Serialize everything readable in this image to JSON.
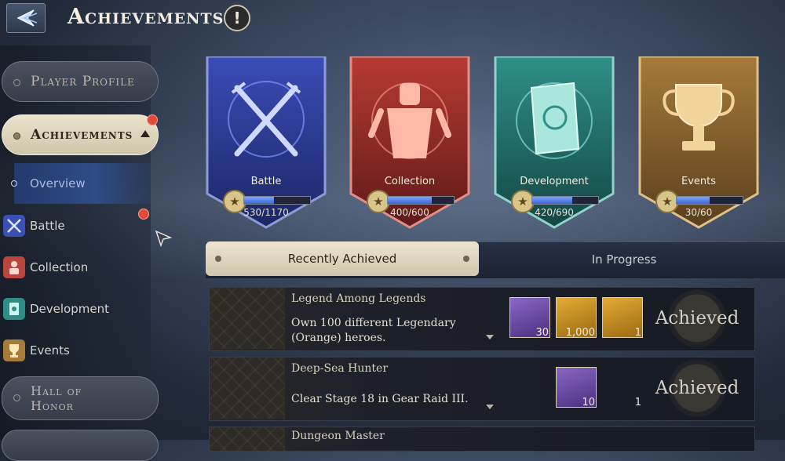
{
  "header": {
    "title": "Achievements",
    "info_symbol": "!"
  },
  "sidebar": {
    "player_profile": "Player Profile",
    "achievements": "Achievements",
    "overview": "Overview",
    "categories": [
      {
        "label": "Battle",
        "icon": "battle-icon",
        "color": "#4a5fd0"
      },
      {
        "label": "Collection",
        "icon": "collection-icon",
        "color": "#c2473c"
      },
      {
        "label": "Development",
        "icon": "development-icon",
        "color": "#3f9a92"
      },
      {
        "label": "Events",
        "icon": "events-icon",
        "color": "#c79a45"
      }
    ],
    "hall_of_honor": "Hall of Honor"
  },
  "banners": [
    {
      "label": "Battle",
      "count": "530/1170",
      "progress": 0.45,
      "color_top": "#3a4cb8",
      "color_bottom": "#1c2664",
      "icon": "crossed-swords-icon"
    },
    {
      "label": "Collection",
      "count": "400/600",
      "progress": 0.67,
      "color_top": "#b83a33",
      "color_bottom": "#5e1a18",
      "icon": "knight-icon"
    },
    {
      "label": "Development",
      "count": "420/690",
      "progress": 0.61,
      "color_top": "#2f8f89",
      "color_bottom": "#134744",
      "icon": "book-icon"
    },
    {
      "label": "Events",
      "count": "30/60",
      "progress": 0.5,
      "color_top": "#a77a3a",
      "color_bottom": "#5a3f1d",
      "icon": "trophy-icon"
    }
  ],
  "tabs": {
    "recent": "Recently Achieved",
    "progress": "In Progress"
  },
  "achievements": [
    {
      "name": "Legend Among Legends",
      "description": "Own 100 different Legendary (Orange) heroes.",
      "rewards": [
        {
          "type": "purple",
          "qty": "30"
        },
        {
          "type": "gold",
          "qty": "1,000"
        },
        {
          "type": "gold",
          "qty": "1"
        }
      ],
      "status": "Achieved"
    },
    {
      "name": "Deep-Sea Hunter",
      "description": "Clear Stage 18 in Gear Raid III.",
      "rewards": [
        {
          "type": "purple",
          "qty": "10"
        },
        {
          "type": "none",
          "qty": "1"
        }
      ],
      "status": "Achieved"
    },
    {
      "name": "Dungeon Master",
      "description": "",
      "rewards": [],
      "status": ""
    }
  ]
}
